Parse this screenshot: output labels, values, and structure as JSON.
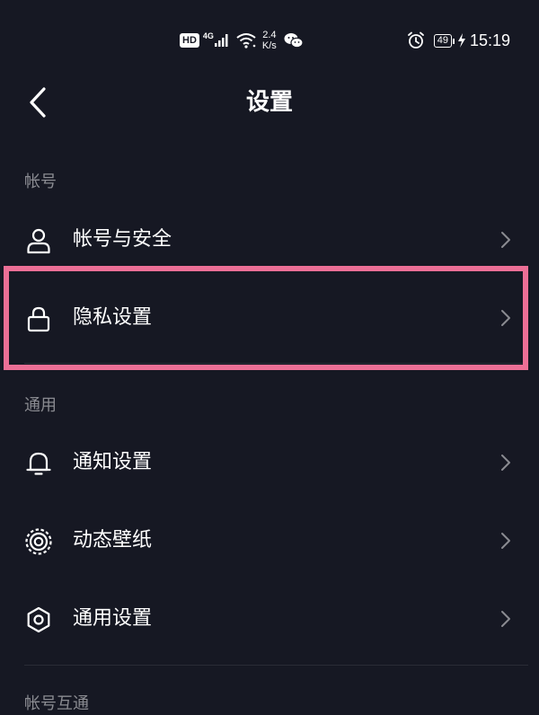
{
  "status_bar": {
    "hd_label": "HD",
    "network_type": "4G",
    "speed_value": "2.4",
    "speed_unit": "K/s",
    "battery_level": "49",
    "time": "15:19"
  },
  "header": {
    "title": "设置"
  },
  "sections": {
    "account": {
      "header": "帐号",
      "items": [
        {
          "label": "帐号与安全",
          "icon": "user-icon"
        },
        {
          "label": "隐私设置",
          "icon": "lock-icon"
        }
      ]
    },
    "general": {
      "header": "通用",
      "items": [
        {
          "label": "通知设置",
          "icon": "bell-icon"
        },
        {
          "label": "动态壁纸",
          "icon": "wallpaper-icon"
        },
        {
          "label": "通用设置",
          "icon": "gear-icon"
        }
      ]
    },
    "interop": {
      "header": "帐号互通"
    }
  },
  "colors": {
    "background": "#161823",
    "highlight": "#ec6f96",
    "section_header": "#8a8b91",
    "divider": "#2a2c36"
  }
}
